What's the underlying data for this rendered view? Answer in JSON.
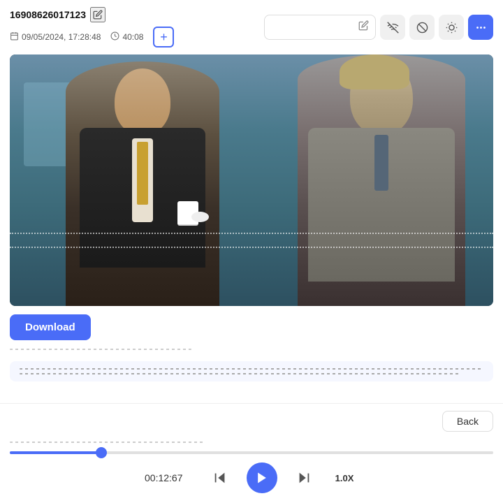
{
  "header": {
    "id": "16908626017123",
    "date": "09/05/2024, 17:28:48",
    "duration": "40:08",
    "add_label": "+",
    "edit_icon": "✏",
    "calendar_icon": "📅",
    "clock_icon": "🕐"
  },
  "toolbar": {
    "search_placeholder": "",
    "pen_icon": "✏",
    "wifi_off_icon": "📶",
    "block_icon": "🚫",
    "brightness_icon": "☀",
    "more_icon": "•••"
  },
  "video": {
    "dotted_lines": true
  },
  "actions": {
    "download_label": "Download"
  },
  "scene_panel": {
    "back_label": "Back"
  },
  "player": {
    "time": "00:12:67",
    "speed": "1.0X",
    "progress_percent": 19,
    "rewind_icon": "⏮",
    "play_icon": "▶",
    "forward_icon": "⏭"
  }
}
